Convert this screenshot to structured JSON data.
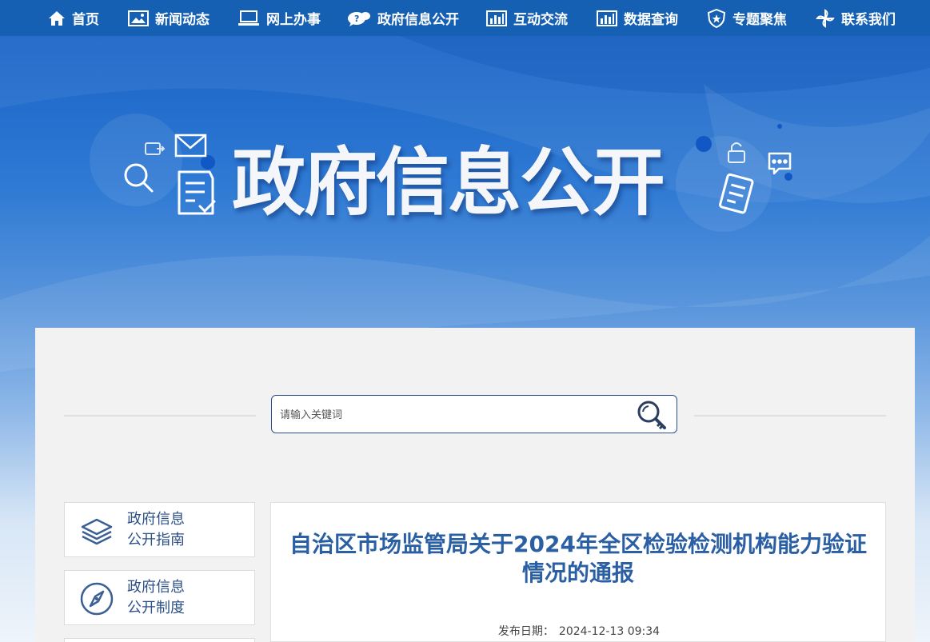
{
  "nav": {
    "items": [
      {
        "label": "首页",
        "icon": "home-icon"
      },
      {
        "label": "新闻动态",
        "icon": "image-icon"
      },
      {
        "label": "网上办事",
        "icon": "laptop-icon"
      },
      {
        "label": "政府信息公开",
        "icon": "chat-bubble-icon"
      },
      {
        "label": "互动交流",
        "icon": "bar-chart-icon"
      },
      {
        "label": "数据查询",
        "icon": "bar-chart-icon"
      },
      {
        "label": "专题聚焦",
        "icon": "shield-star-icon"
      },
      {
        "label": "联系我们",
        "icon": "pinwheel-icon"
      }
    ]
  },
  "banner": {
    "title": "政府信息公开"
  },
  "search": {
    "placeholder": "请输入关键词"
  },
  "sidebar": {
    "items": [
      {
        "line1": "政府信息",
        "line2": "公开指南",
        "icon": "layers-icon"
      },
      {
        "line1": "政府信息",
        "line2": "公开制度",
        "icon": "compass-icon"
      }
    ]
  },
  "article": {
    "title": "自治区市场监管局关于2024年全区检验检测机构能力验证情况的通报",
    "date_label": "发布日期：",
    "date_value": "2024-12-13 09:34"
  },
  "colors": {
    "nav_bg": "#1560b3",
    "accent": "#2b5fa3",
    "panel_bg": "#f2f2f2"
  }
}
